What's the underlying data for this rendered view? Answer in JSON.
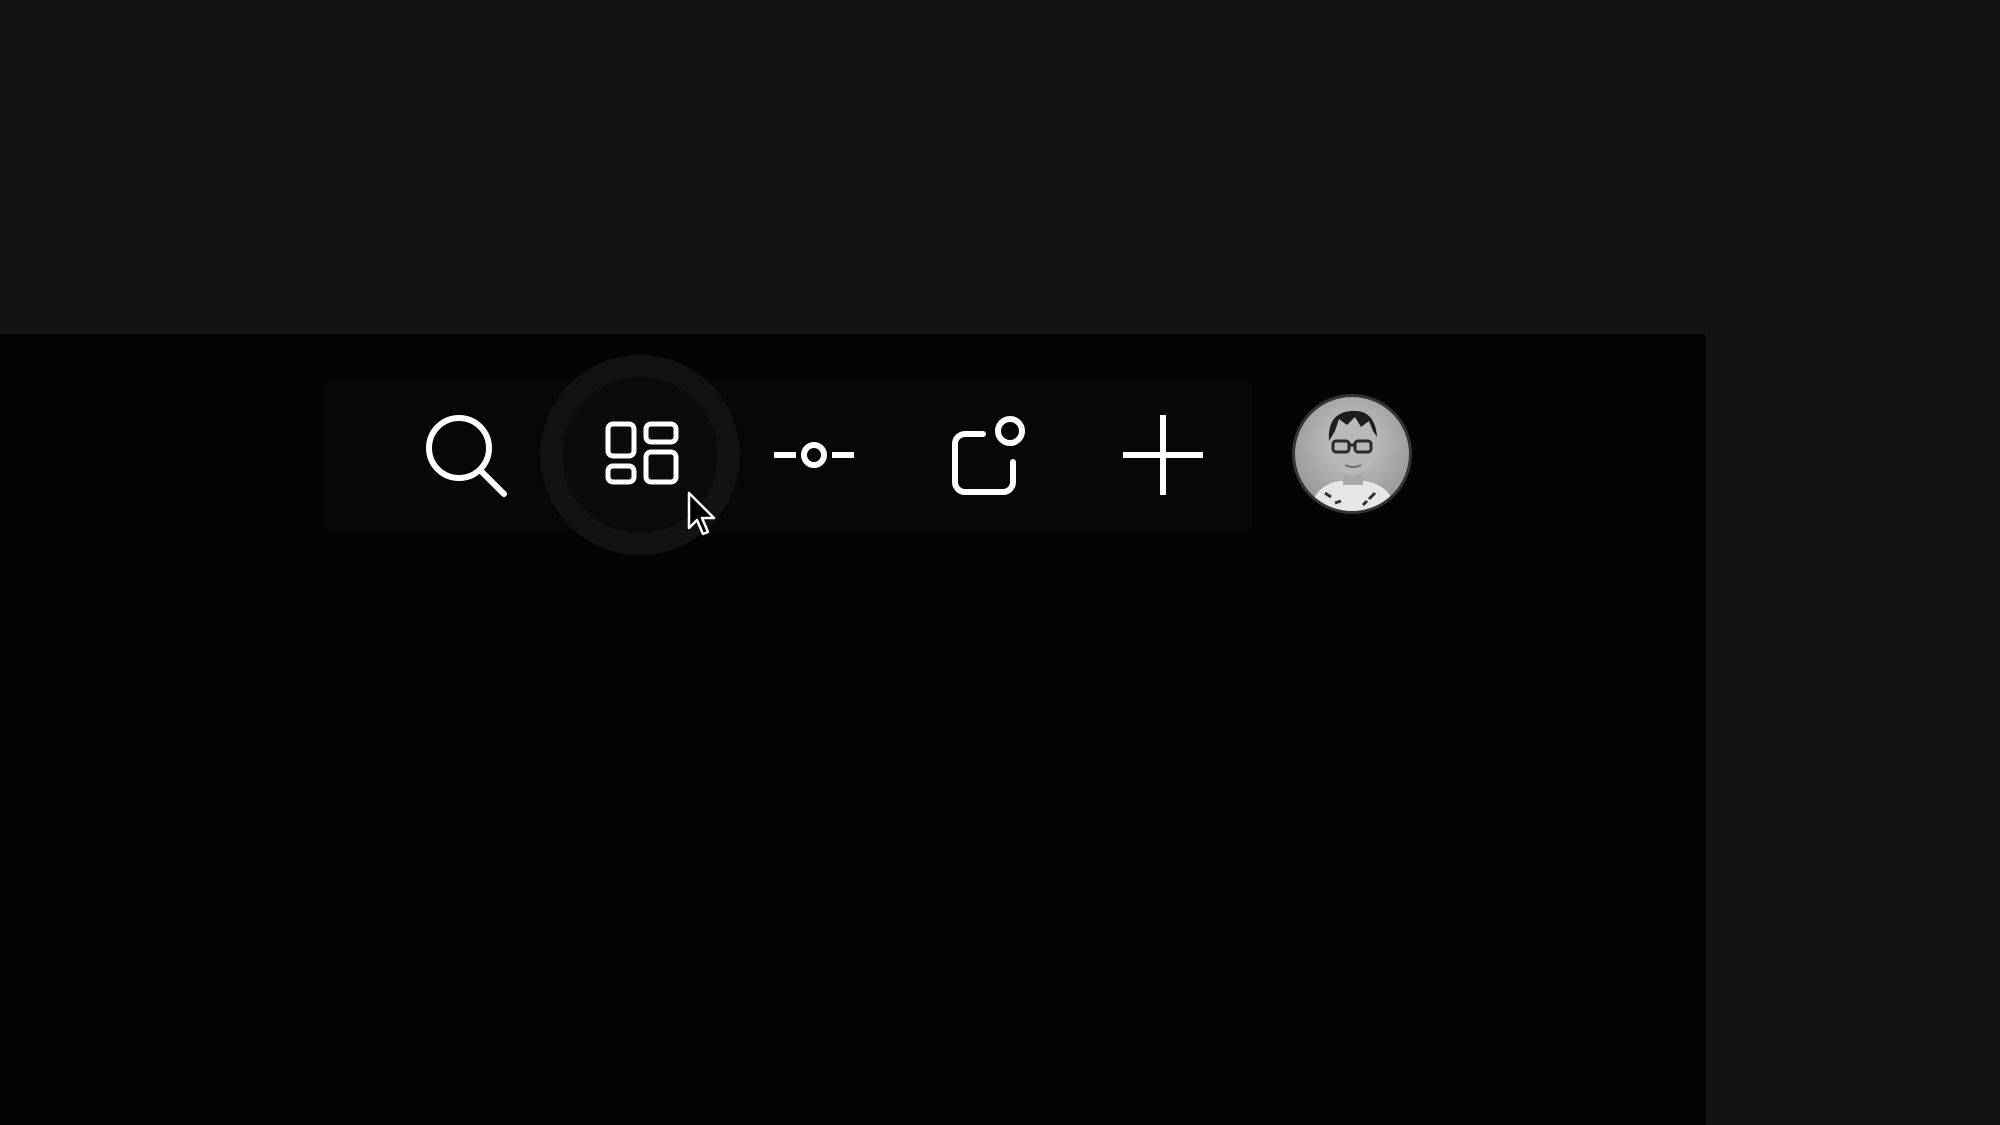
{
  "theme": {
    "page_bg": "#131313",
    "panel_bg": "#040404",
    "toolbar_bg": "#070707",
    "icon_color": "#ffffff",
    "hover_ring": "#121212"
  },
  "toolbar": {
    "buttons": [
      {
        "id": "search",
        "icon": "search-icon",
        "active": false
      },
      {
        "id": "apps",
        "icon": "grid-icon",
        "active": true
      },
      {
        "id": "commits",
        "icon": "commit-icon",
        "active": false
      },
      {
        "id": "notifications",
        "icon": "notification-icon",
        "active": false
      },
      {
        "id": "create",
        "icon": "plus-icon",
        "active": false
      }
    ],
    "avatar": {
      "icon": "user-avatar",
      "style": "grayscale photo"
    }
  },
  "cursor": {
    "icon": "arrow-pointer-icon",
    "over": "apps"
  }
}
